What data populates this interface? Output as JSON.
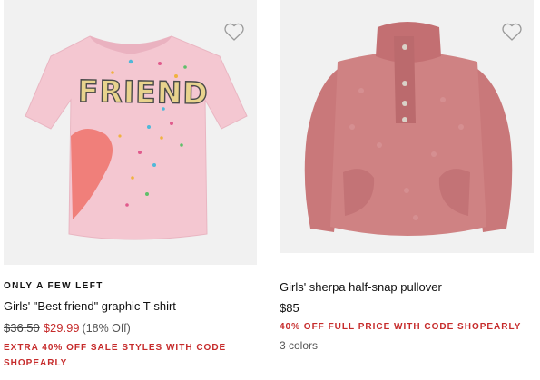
{
  "products": [
    {
      "flag": "ONLY A FEW LEFT",
      "title": "Girls' \"Best friend\" graphic T-shirt",
      "original_price": "$36.50",
      "sale_price": "$29.99",
      "discount": "(18% Off)",
      "promo": "EXTRA 40% OFF SALE STYLES WITH CODE SHOPEARLY",
      "graphic_text": "FRIEND",
      "wishlist_icon": "heart-outline-icon"
    },
    {
      "title": "Girls' sherpa half-snap pullover",
      "price": "$85",
      "promo": "40% OFF FULL PRICE WITH CODE SHOPEARLY",
      "colors": "3 colors",
      "wishlist_icon": "heart-outline-icon"
    }
  ],
  "colors": {
    "sale_red": "#c62b2b",
    "image_bg": "#f1f1f1",
    "tshirt_pink": "#f4c7d1",
    "heart_coral": "#f07f7a",
    "sherpa_rose": "#c9787a"
  }
}
